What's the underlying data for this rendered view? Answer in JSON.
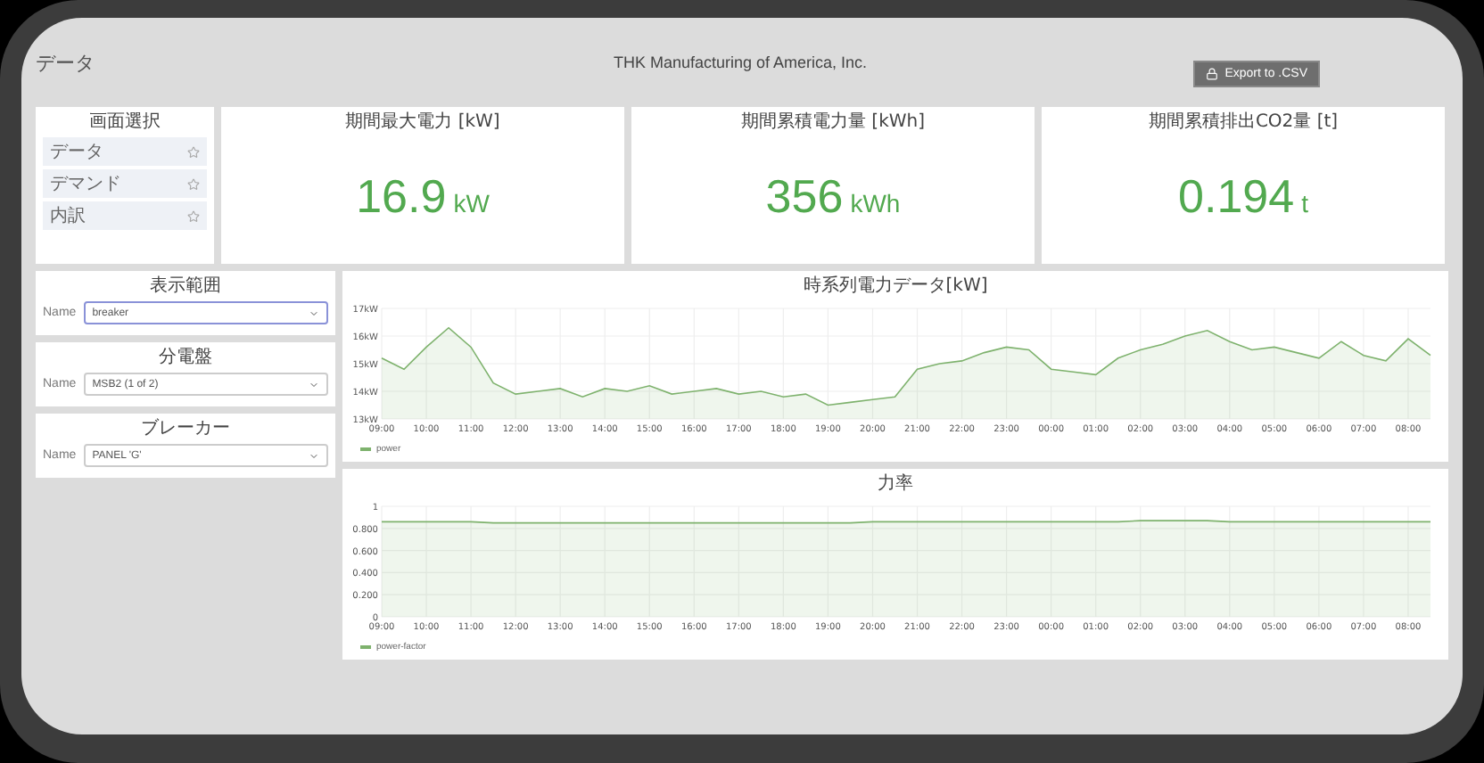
{
  "header": {
    "title": "データ",
    "company": "THK Manufacturing of America, Inc.",
    "export_button": "Export to .CSV"
  },
  "menu": {
    "title": "画面選択",
    "items": [
      {
        "label": "データ"
      },
      {
        "label": "デマンド"
      },
      {
        "label": "内訳"
      }
    ]
  },
  "stats": [
    {
      "title": "期間最大電力 [kW]",
      "value": "16.9",
      "unit": "kW"
    },
    {
      "title": "期間累積電力量 [kWh]",
      "value": "356",
      "unit": "kWh"
    },
    {
      "title": "期間累積排出CO2量 [t]",
      "value": "0.194",
      "unit": "t"
    }
  ],
  "filters": [
    {
      "title": "表示範囲",
      "label": "Name",
      "value": "breaker",
      "focused": true
    },
    {
      "title": "分電盤",
      "label": "Name",
      "value": "MSB2 (1 of 2)",
      "focused": false
    },
    {
      "title": "ブレーカー",
      "label": "Name",
      "value": "PANEL 'G'",
      "focused": false
    }
  ],
  "charts": [
    {
      "title": "時系列電力データ[kW]",
      "chart_data": {
        "type": "area",
        "grid": true,
        "categories": [
          "09:00",
          null,
          "10:00",
          null,
          "11:00",
          null,
          "12:00",
          null,
          "13:00",
          null,
          "14:00",
          null,
          "15:00",
          null,
          "16:00",
          null,
          "17:00",
          null,
          "18:00",
          null,
          "19:00",
          null,
          "20:00",
          null,
          "21:00",
          null,
          "22:00",
          null,
          "23:00",
          null,
          "00:00",
          null,
          "01:00",
          null,
          "02:00",
          null,
          "03:00",
          null,
          "04:00",
          null,
          "05:00",
          null,
          "06:00",
          null,
          "07:00",
          null,
          "08:00",
          null
        ],
        "ylim": [
          13,
          17
        ],
        "yticks": [
          {
            "value": 13,
            "label": "13kW"
          },
          {
            "value": 14,
            "label": "14kW"
          },
          {
            "value": 15,
            "label": "15kW"
          },
          {
            "value": 16,
            "label": "16kW"
          },
          {
            "value": 17,
            "label": "17kW"
          }
        ],
        "series": [
          {
            "name": "power",
            "color": "#7eb26d",
            "values": [
              15.2,
              14.8,
              15.6,
              16.3,
              15.6,
              14.3,
              13.9,
              14.0,
              14.1,
              13.8,
              14.1,
              14.0,
              14.2,
              13.9,
              14.0,
              14.1,
              13.9,
              14.0,
              13.8,
              13.9,
              13.5,
              13.6,
              13.7,
              13.8,
              14.8,
              15.0,
              15.1,
              15.4,
              15.6,
              15.5,
              14.8,
              14.7,
              14.6,
              15.2,
              15.5,
              15.7,
              16.0,
              16.2,
              15.8,
              15.5,
              15.6,
              15.4,
              15.2,
              15.8,
              15.3,
              15.1,
              15.9,
              15.3
            ]
          }
        ]
      }
    },
    {
      "title": "力率",
      "chart_data": {
        "type": "area",
        "grid": true,
        "categories": [
          "09:00",
          null,
          "10:00",
          null,
          "11:00",
          null,
          "12:00",
          null,
          "13:00",
          null,
          "14:00",
          null,
          "15:00",
          null,
          "16:00",
          null,
          "17:00",
          null,
          "18:00",
          null,
          "19:00",
          null,
          "20:00",
          null,
          "21:00",
          null,
          "22:00",
          null,
          "23:00",
          null,
          "00:00",
          null,
          "01:00",
          null,
          "02:00",
          null,
          "03:00",
          null,
          "04:00",
          null,
          "05:00",
          null,
          "06:00",
          null,
          "07:00",
          null,
          "08:00",
          null
        ],
        "ylim": [
          0,
          1
        ],
        "yticks": [
          {
            "value": 0,
            "label": "0"
          },
          {
            "value": 0.2,
            "label": "0.200"
          },
          {
            "value": 0.4,
            "label": "0.400"
          },
          {
            "value": 0.6,
            "label": "0.600"
          },
          {
            "value": 0.8,
            "label": "0.800"
          },
          {
            "value": 1,
            "label": "1"
          }
        ],
        "series": [
          {
            "name": "power-factor",
            "color": "#7eb26d",
            "values": [
              0.86,
              0.86,
              0.86,
              0.86,
              0.86,
              0.85,
              0.85,
              0.85,
              0.85,
              0.85,
              0.85,
              0.85,
              0.85,
              0.85,
              0.85,
              0.85,
              0.85,
              0.85,
              0.85,
              0.85,
              0.85,
              0.85,
              0.86,
              0.86,
              0.86,
              0.86,
              0.86,
              0.86,
              0.86,
              0.86,
              0.86,
              0.86,
              0.86,
              0.86,
              0.87,
              0.87,
              0.87,
              0.87,
              0.86,
              0.86,
              0.86,
              0.86,
              0.86,
              0.86,
              0.86,
              0.86,
              0.86,
              0.86
            ]
          }
        ]
      }
    }
  ]
}
